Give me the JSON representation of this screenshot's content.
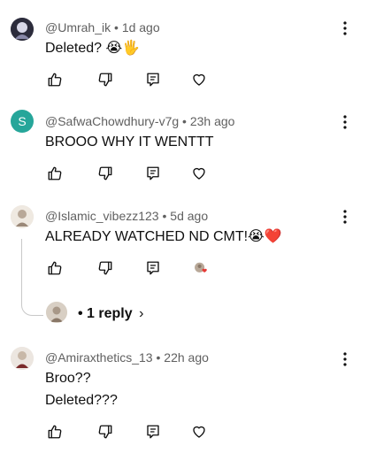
{
  "comments": [
    {
      "author": "@Umrah_ik",
      "sep": " • ",
      "time": "1d ago",
      "lines": [
        "Deleted? 😭🖐️"
      ]
    },
    {
      "author": "@SafwaChowdhury-v7g",
      "sep": " • ",
      "time": "23h ago",
      "avatar_letter": "S",
      "lines": [
        "BROOO WHY IT WENTTT"
      ]
    },
    {
      "author": "@Islamic_vibezz123",
      "sep": " • ",
      "time": "5d ago",
      "lines": [
        "ALREADY WATCHED ND CMT!😭❤️"
      ]
    },
    {
      "author": "@Amiraxthetics_13",
      "sep": " • ",
      "time": "22h ago",
      "lines": [
        "Broo??",
        "Deleted???"
      ]
    }
  ],
  "replies": {
    "label": "• 1 reply",
    "chevron": "›"
  },
  "colors": {
    "avatar_s_bg": "#26a69a",
    "heart": "#e53935",
    "meta": "#606060"
  },
  "icons": [
    "like-icon",
    "dislike-icon",
    "reply-icon",
    "heart-icon",
    "more-vert-icon",
    "chevron-right-icon"
  ]
}
